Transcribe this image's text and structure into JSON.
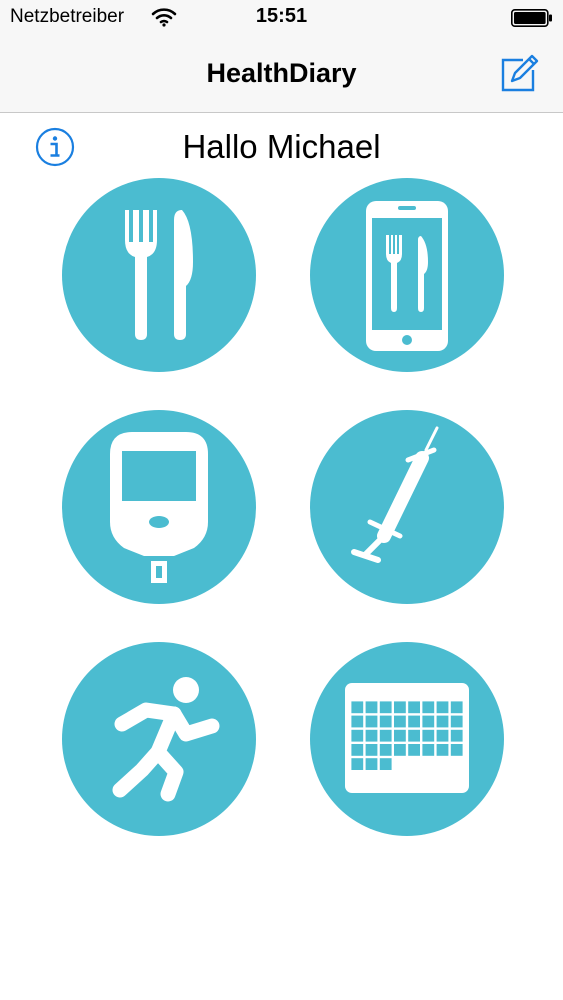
{
  "status_bar": {
    "carrier": "Netzbetreiber",
    "time": "15:51"
  },
  "nav": {
    "title": "HealthDiary",
    "compose_icon": "compose-icon"
  },
  "greeting": "Hallo Michael",
  "info_icon": "info-icon",
  "colors": {
    "accent": "#1a7fe0",
    "tile": "#4bbcd0",
    "icon": "#ffffff"
  },
  "tiles": [
    {
      "icon": "fork-knife-icon"
    },
    {
      "icon": "phone-meal-icon"
    },
    {
      "icon": "glucose-meter-icon"
    },
    {
      "icon": "syringe-icon"
    },
    {
      "icon": "running-person-icon"
    },
    {
      "icon": "calendar-icon"
    }
  ]
}
